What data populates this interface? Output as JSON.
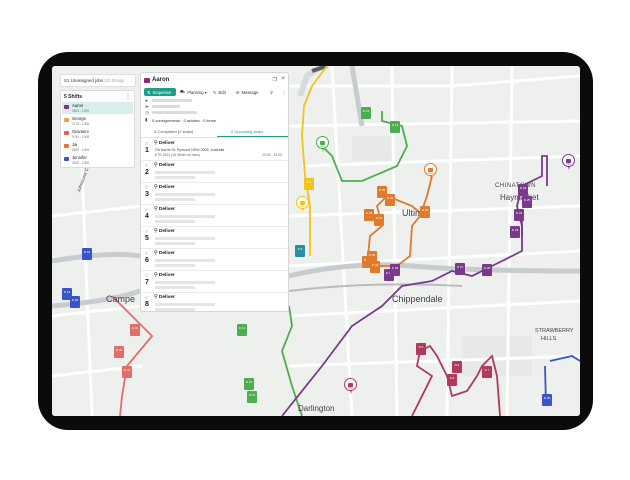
{
  "map": {
    "place_labels": [
      {
        "name": "ultimo",
        "text": "Ultimo",
        "size": 9
      },
      {
        "name": "chinatown",
        "text": "CHINATOWN",
        "size": 6
      },
      {
        "name": "haymarket",
        "text": "Haymarket",
        "size": 8
      },
      {
        "name": "chippendale",
        "text": "Chippendale",
        "size": 9
      },
      {
        "name": "campe",
        "text": "Campe",
        "size": 9
      },
      {
        "name": "strawberry",
        "text": "STRAWBERRY",
        "size": 5.5
      },
      {
        "name": "hills",
        "text": "HILLS",
        "size": 5.5
      },
      {
        "name": "darlington",
        "text": "Darlington",
        "size": 8
      },
      {
        "name": "johnstone-creek",
        "text": "Johnstone Creek",
        "size": 4.5
      }
    ]
  },
  "shifts": {
    "filter_label": "S1 Unassigned jobs",
    "filter_count": "1/2 Group",
    "title": "5 Shifts",
    "items": [
      {
        "name": "Aaron",
        "time": "0815 - 1009",
        "color": "#8a2a78"
      },
      {
        "name": "George",
        "time": "0715 - 1008",
        "color": "#e8a33b"
      },
      {
        "name": "Giovanni",
        "time": "0740 - 1008",
        "color": "#e0605d"
      },
      {
        "name": "Jai",
        "time": "0830 - 1009",
        "color": "#e07a2c"
      },
      {
        "name": "Jennifer",
        "time": "0915 - 1008",
        "color": "#3a56c4"
      }
    ]
  },
  "panel": {
    "title": "Aaron",
    "toolbar": {
      "sequence": "Sequence",
      "planning": "Planning",
      "edit": "Edit",
      "message": "Message"
    },
    "stats": "0 consignments  ·  0 articles  ·  0 items",
    "tabs": {
      "completed": "0 Completed (0 stops)",
      "upcoming": "0 Upcoming stops"
    },
    "stops": [
      {
        "num": "1",
        "action": "Deliver",
        "address": "Oh Harris St, Pyrmont NSW 2009, Australia",
        "window": "ETE 1502 (16:30min ea mins)",
        "eta": "22:00 · 23:00"
      },
      {
        "num": "2",
        "action": "Deliver"
      },
      {
        "num": "3",
        "action": "Deliver"
      },
      {
        "num": "4",
        "action": "Deliver"
      },
      {
        "num": "5",
        "action": "Deliver"
      },
      {
        "num": "6",
        "action": "Deliver"
      },
      {
        "num": "7",
        "action": "Deliver"
      },
      {
        "num": "8",
        "action": "Deliver"
      }
    ]
  },
  "colors": {
    "purple": "#7a3a8c",
    "orange": "#e07a2c",
    "green": "#4cae4f",
    "red": "#e06c6c",
    "crimson": "#b03a5c",
    "blue": "#3a56c4",
    "teal": "#2a8f9e",
    "yellow": "#f0c419",
    "accent": "#1e9e84"
  },
  "markers": [
    {
      "label": "D 12",
      "color": "#4cae4f"
    },
    {
      "label": "D 13",
      "color": "#4cae4f"
    },
    {
      "label": "D 38",
      "color": "#e07a2c"
    },
    {
      "label": "D 39",
      "color": "#e07a2c"
    },
    {
      "label": "D 40",
      "color": "#e07a2c"
    },
    {
      "label": "D 41",
      "color": "#e07a2c"
    },
    {
      "label": "D 42",
      "color": "#e07a2c"
    },
    {
      "label": "D 43",
      "color": "#e07a2c"
    },
    {
      "label": "D 44",
      "color": "#e07a2c"
    },
    {
      "label": "D 45",
      "color": "#e07a2c"
    },
    {
      "label": "D 22",
      "color": "#7a3a8c"
    },
    {
      "label": "D 23",
      "color": "#7a3a8c"
    },
    {
      "label": "D 24",
      "color": "#7a3a8c"
    },
    {
      "label": "D 25",
      "color": "#7a3a8c"
    },
    {
      "label": "D 26",
      "color": "#7a3a8c"
    },
    {
      "label": "D 27",
      "color": "#7a3a8c"
    },
    {
      "label": "D 28",
      "color": "#7a3a8c"
    },
    {
      "label": "D 29",
      "color": "#7a3a8c"
    },
    {
      "label": "D 5",
      "color": "#b03a5c"
    },
    {
      "label": "D 6",
      "color": "#b03a5c"
    },
    {
      "label": "D 7",
      "color": "#b03a5c"
    },
    {
      "label": "D 8",
      "color": "#b03a5c"
    },
    {
      "label": "D 14",
      "color": "#4cae4f"
    },
    {
      "label": "D 15",
      "color": "#4cae4f"
    },
    {
      "label": "D 16",
      "color": "#4cae4f"
    },
    {
      "label": "D 40",
      "color": "#e06c6c"
    },
    {
      "label": "D 41",
      "color": "#e06c6c"
    },
    {
      "label": "D 42",
      "color": "#e06c6c"
    },
    {
      "label": "D 6",
      "color": "#2a8f9e"
    },
    {
      "label": "D 1",
      "color": "#f0c419"
    },
    {
      "label": "D 18",
      "color": "#3a56c4"
    },
    {
      "label": "D 19",
      "color": "#3a56c4"
    },
    {
      "label": "D 20",
      "color": "#3a56c4"
    },
    {
      "label": "D 36",
      "color": "#3a56c4"
    }
  ],
  "depots": [
    {
      "label": "GEO",
      "color": "#4cae4f"
    },
    {
      "label": "GEO",
      "color": "#e07a2c"
    },
    {
      "label": "GEO",
      "color": "#f0c419"
    },
    {
      "label": "STO",
      "color": "#b03a5c"
    },
    {
      "label": "STO",
      "color": "#7a3a8c"
    }
  ]
}
